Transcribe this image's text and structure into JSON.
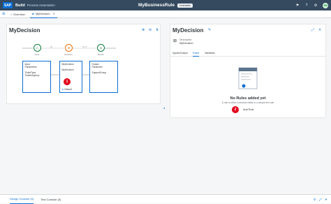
{
  "shell": {
    "logo": "SAP",
    "brand": "Build",
    "subtitle": "Process Automation",
    "title": "MyBusinessRule",
    "status": "Deletable",
    "avatar": "SN"
  },
  "tabs": [
    {
      "label": "Overview"
    },
    {
      "label": "MyDecision"
    }
  ],
  "left_panel": {
    "title": "MyDecision",
    "nodes": {
      "input": "Input",
      "decision": "Decision",
      "result": "Result"
    },
    "boxes": {
      "input": {
        "heading": "Input",
        "sub": "Parameters",
        "items": [
          "TicketType",
          "TicketUrgency"
        ]
      },
      "decision": {
        "heading": "MyDecision",
        "items": [
          "MyDecision"
        ],
        "footer": "Default"
      },
      "output": {
        "heading": "Output",
        "sub": "Parameter",
        "items": [
          "SupportGroup"
        ]
      }
    },
    "links": [
      "IN",
      "OUT"
    ],
    "badge": "1"
  },
  "right_panel": {
    "title": "MyDecision",
    "description_label": "Description",
    "description_value": "MyDecision",
    "tabs": [
      "Inputs/Output",
      "Rules",
      "Variables"
    ],
    "empty_title": "No Rules added yet",
    "empty_text": "A rule is either a decision table or a simple text rule",
    "add_rule": "Add Rule",
    "badge": "2"
  },
  "bottom": {
    "tabs": [
      "Design Console (0)",
      "Test Console (0)"
    ]
  },
  "colors": {
    "shell": "#354a5f",
    "accent": "#0a6ed1",
    "badge": "#e2001a",
    "input": "#107e3e",
    "decision": "#e9730c"
  }
}
